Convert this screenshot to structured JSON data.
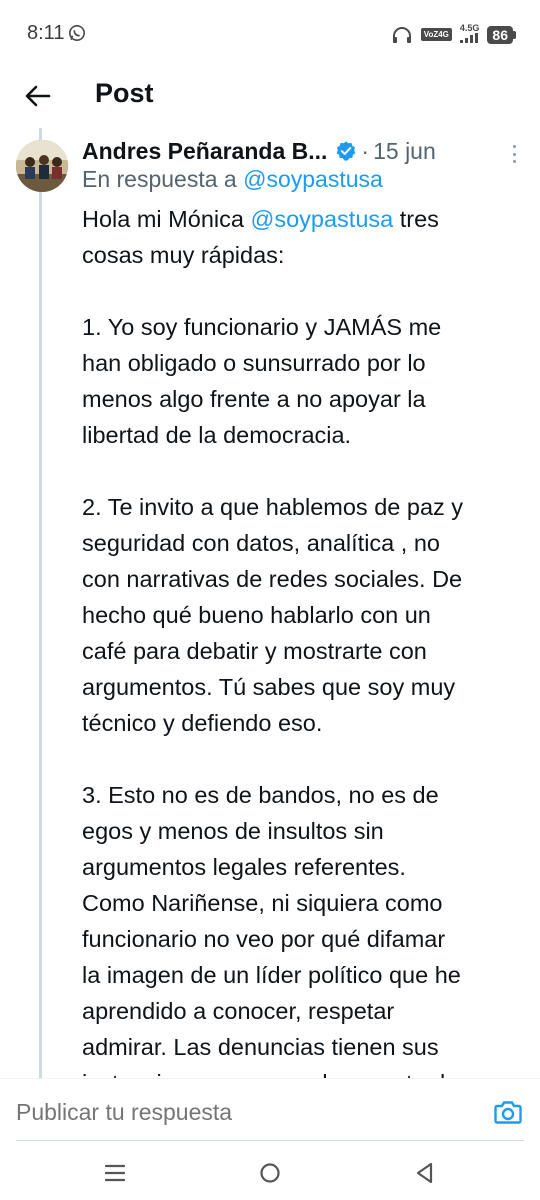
{
  "status_bar": {
    "time": "8:11",
    "network_label": "VoZ4G",
    "signal_label": "4.5G",
    "battery_level": "86"
  },
  "header": {
    "title": "Post"
  },
  "post": {
    "author": "Andres Peñaranda B...",
    "date_separator": "·",
    "date": "15 jun",
    "reply_prefix": "En respuesta a",
    "reply_handle": "@soypastusa",
    "body_lines": [
      {
        "pre": "Hola mi Mónica ",
        "link": "@soypastusa",
        "post": " tres"
      },
      {
        "pre": "cosas muy rápidas:"
      },
      {
        "pre": ""
      },
      {
        "pre": "1. Yo soy funcionario y JAMÁS me"
      },
      {
        "pre": "han obligado o sunsurrado por lo"
      },
      {
        "pre": "menos algo frente a no apoyar la"
      },
      {
        "pre": "libertad de la democracia."
      },
      {
        "pre": ""
      },
      {
        "pre": "2. Te invito a que hablemos de paz y"
      },
      {
        "pre": "seguridad con datos, analítica , no"
      },
      {
        "pre": "con narrativas de redes sociales. De"
      },
      {
        "pre": "hecho qué bueno hablarlo con un"
      },
      {
        "pre": "café para debatir y mostrarte con"
      },
      {
        "pre": "argumentos. Tú sabes que soy muy"
      },
      {
        "pre": "técnico y defiendo eso."
      },
      {
        "pre": ""
      },
      {
        "pre": "3. Esto no es de bandos, no es de"
      },
      {
        "pre": "egos y menos de insultos sin"
      },
      {
        "pre": "argumentos legales referentes."
      },
      {
        "pre": "Como Nariñense, ni siquiera como"
      },
      {
        "pre": "funcionario no veo por qué difamar"
      },
      {
        "pre": "la imagen de un líder político que he"
      },
      {
        "pre": "aprendido a conocer, respetar"
      },
      {
        "pre": "admirar. Las denuncias tienen sus"
      },
      {
        "pre": "instancias y no se pueden montar la"
      }
    ]
  },
  "reply_bar": {
    "placeholder": "Publicar tu respuesta"
  },
  "colors": {
    "link": "#1d9bf0",
    "secondary_text": "#536471",
    "verified": "#1d9bf0"
  }
}
